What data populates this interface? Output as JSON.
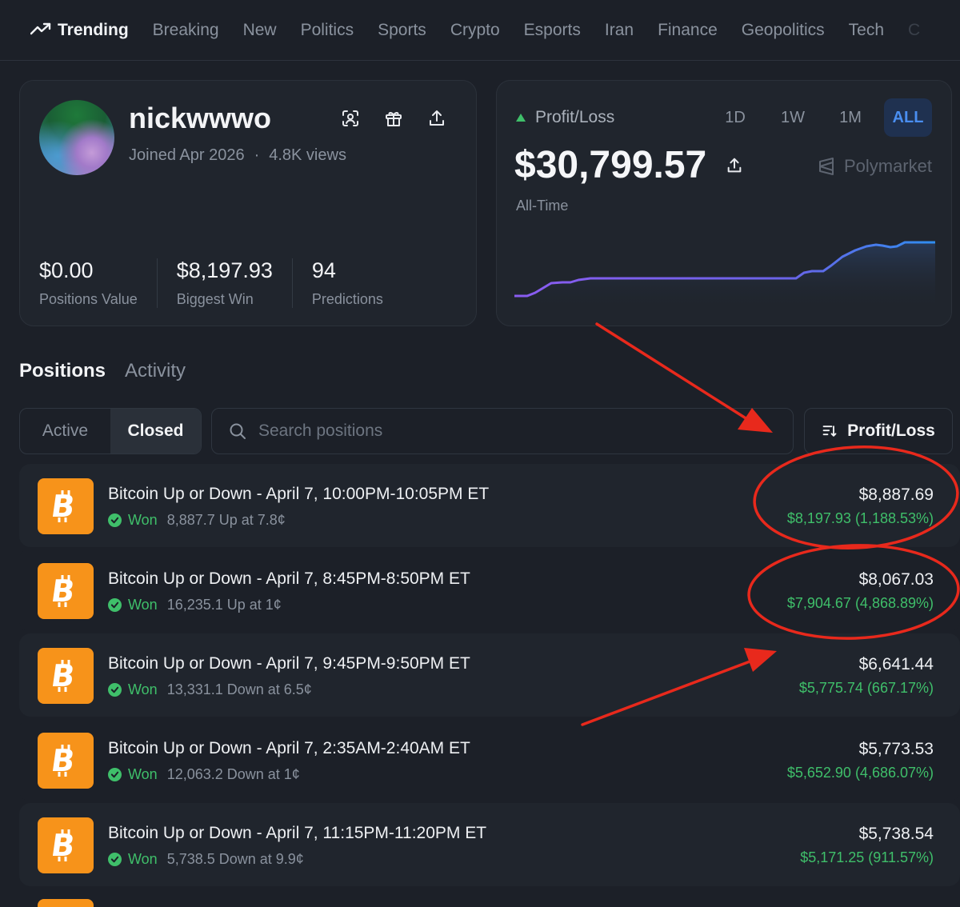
{
  "nav": {
    "items": [
      {
        "label": "Trending",
        "active": true
      },
      {
        "label": "Breaking"
      },
      {
        "label": "New"
      },
      {
        "label": "Politics"
      },
      {
        "label": "Sports"
      },
      {
        "label": "Crypto"
      },
      {
        "label": "Esports"
      },
      {
        "label": "Iran"
      },
      {
        "label": "Finance"
      },
      {
        "label": "Geopolitics"
      },
      {
        "label": "Tech"
      },
      {
        "label": "C"
      }
    ]
  },
  "profile": {
    "username": "nickwwwo",
    "joined": "Joined Apr 2026",
    "separator": "·",
    "views": "4.8K views",
    "stats": [
      {
        "value": "$0.00",
        "label": "Positions Value"
      },
      {
        "value": "$8,197.93",
        "label": "Biggest Win"
      },
      {
        "value": "94",
        "label": "Predictions"
      }
    ]
  },
  "pnl": {
    "title": "Profit/Loss",
    "ranges": [
      "1D",
      "1W",
      "1M",
      "ALL"
    ],
    "active_range": "ALL",
    "value": "$30,799.57",
    "period": "All-Time",
    "brand": "Polymarket"
  },
  "tabs": {
    "positions": "Positions",
    "activity": "Activity"
  },
  "filters": {
    "active": "Active",
    "closed": "Closed",
    "search_placeholder": "Search positions",
    "sort_label": "Profit/Loss"
  },
  "positions": [
    {
      "title": "Bitcoin Up or Down - April 7, 10:00PM-10:05PM ET",
      "status": "Won",
      "detail": "8,887.7 Up at 7.8¢",
      "value": "$8,887.69",
      "pnl": "$8,197.93 (1,188.53%)"
    },
    {
      "title": "Bitcoin Up or Down - April 7, 8:45PM-8:50PM ET",
      "status": "Won",
      "detail": "16,235.1 Up at 1¢",
      "value": "$8,067.03",
      "pnl": "$7,904.67 (4,868.89%)"
    },
    {
      "title": "Bitcoin Up or Down - April 7, 9:45PM-9:50PM ET",
      "status": "Won",
      "detail": "13,331.1 Down at 6.5¢",
      "value": "$6,641.44",
      "pnl": "$5,775.74 (667.17%)"
    },
    {
      "title": "Bitcoin Up or Down - April 7, 2:35AM-2:40AM ET",
      "status": "Won",
      "detail": "12,063.2 Down at 1¢",
      "value": "$5,773.53",
      "pnl": "$5,652.90 (4,686.07%)"
    },
    {
      "title": "Bitcoin Up or Down - April 7, 11:15PM-11:20PM ET",
      "status": "Won",
      "detail": "5,738.5 Down at 9.9¢",
      "value": "$5,738.54",
      "pnl": "$5,171.25 (911.57%)"
    }
  ],
  "colors": {
    "background": "#1c2028",
    "accent_green": "#3fbf6a",
    "accent_blue": "#4a8ef0",
    "bitcoin_orange": "#f7931a",
    "annotation_red": "#e8291c"
  }
}
